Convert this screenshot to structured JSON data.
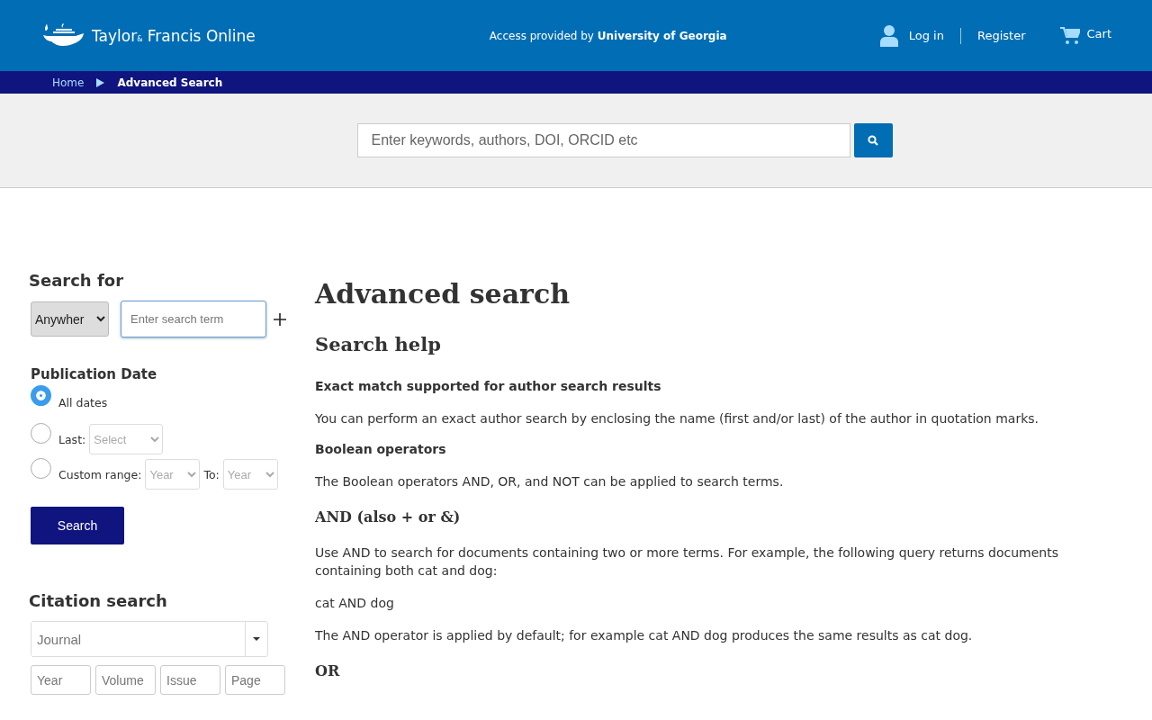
{
  "header": {
    "logo_text": "Taylor$_{&}$ Francis Online",
    "access": "Access provided by **University of Georgia**",
    "login": "Log in",
    "register": "Register",
    "cart": "Cart"
  },
  "breadcrumb": [
    "Home",
    "Advanced Search"
  ],
  "search_bar": {
    "placeholder": "Enter keywords, authors, DOI, ORCID etc"
  },
  "search_for": {
    "heading": "Search for",
    "scope": "Anywher",
    "term_placeholder": "Enter search term"
  },
  "publication_date": {
    "heading": "Publication Date",
    "options": [
      {
        "kind": "all",
        "label": "All dates",
        "selected": true
      },
      {
        "kind": "last",
        "label": "Last:",
        "select": "Select",
        "selected": false
      },
      {
        "kind": "range",
        "label": "Custom range:",
        "select": "Year",
        "to_label": "To:",
        "to_select": "Year",
        "selected": false
      }
    ]
  },
  "search_button": "Search",
  "citation": {
    "heading": "Citation search",
    "journal_placeholder": "Journal",
    "fields": [
      {
        "placeholder": "Year"
      },
      {
        "placeholder": "Volume"
      },
      {
        "placeholder": "Issue"
      },
      {
        "placeholder": "Page"
      }
    ]
  },
  "main": {
    "title": "Advanced search",
    "subtitle": "Search help",
    "blocks": [
      {
        "kind": "label",
        "text": "Exact match supported for author search results"
      },
      {
        "kind": "para",
        "text": "You can perform an exact author search by enclosing the name (first and/or last) of the author in quotation marks."
      },
      {
        "kind": "label",
        "text": "Boolean operators"
      },
      {
        "kind": "para",
        "text": "The Boolean operators AND, OR, and NOT can be applied to search terms."
      },
      {
        "kind": "heading",
        "text": "AND (also + or &)"
      },
      {
        "kind": "para",
        "text": "Use AND to search for documents containing two or more terms. For example, the following query returns documents containing both cat and dog:"
      },
      {
        "kind": "para",
        "text": "cat AND dog"
      },
      {
        "kind": "para",
        "text": "The AND operator is applied by default; for example cat AND dog produces the same results as cat dog."
      },
      {
        "kind": "heading",
        "text": "OR"
      }
    ]
  }
}
